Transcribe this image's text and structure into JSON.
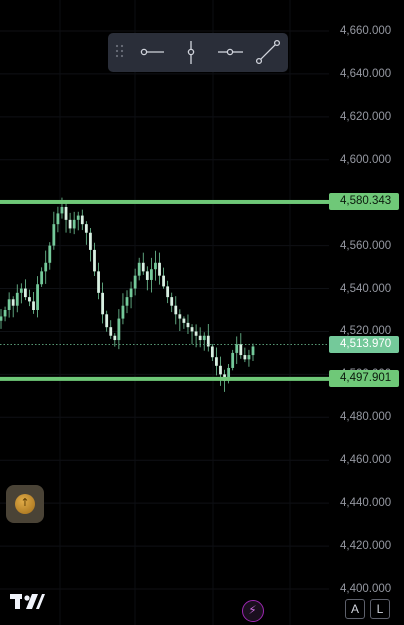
{
  "price_axis": {
    "ticks": [
      "4,660.000",
      "4,640.000",
      "4,620.000",
      "4,600.000",
      "4,580.000",
      "4,560.000",
      "4,540.000",
      "4,520.000",
      "4,500.000",
      "4,480.000",
      "4,460.000",
      "4,440.000",
      "4,420.000",
      "4,400.000"
    ]
  },
  "horizontal_lines": {
    "resistance_label": "4,580.343",
    "support_label": "4,497.901",
    "color": "#6fc878"
  },
  "current_price": {
    "label": "4,513.970",
    "color": "#74c99a"
  },
  "drawing_toolbar": {
    "tools": [
      "drag-handle-icon",
      "horizontal-line-icon",
      "vertical-line-icon",
      "horizontal-ray-icon",
      "trend-line-icon"
    ]
  },
  "bottom_bar": {
    "auto_label": "A",
    "log_label": "L"
  },
  "colors": {
    "background": "#000000",
    "candle": "#74c99a",
    "accent_purple": "#9c27b0",
    "alert_gold": "#d39b3a"
  },
  "chart_data": {
    "type": "candlestick",
    "ylim": [
      4400,
      4660
    ],
    "close_series": [
      4527,
      4530,
      4535,
      4532,
      4538,
      4540,
      4536,
      4534,
      4530,
      4542,
      4548,
      4552,
      4560,
      4570,
      4575,
      4578,
      4572,
      4568,
      4572,
      4574,
      4570,
      4566,
      4558,
      4548,
      4538,
      4528,
      4522,
      4518,
      4516,
      4526,
      4532,
      4536,
      4540,
      4546,
      4552,
      4548,
      4544,
      4549,
      4552,
      4546,
      4541,
      4536,
      4532,
      4528,
      4526,
      4524,
      4522,
      4520,
      4518,
      4516,
      4518,
      4513,
      4508,
      4504,
      4500,
      4497,
      4503,
      4510,
      4514,
      4509,
      4507,
      4509,
      4513
    ],
    "current_price": 4513.97,
    "horizontal_levels": [
      4580.343,
      4497.901
    ]
  }
}
